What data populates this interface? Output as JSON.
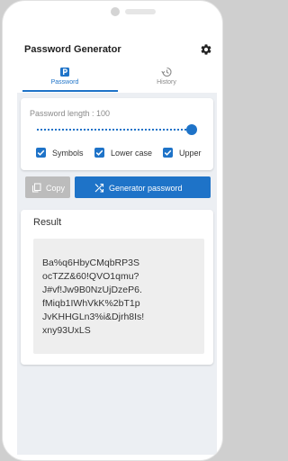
{
  "app": {
    "title": "Password Generator"
  },
  "tabs": [
    {
      "label": "Password",
      "icon": "key-box-icon",
      "active": true
    },
    {
      "label": "History",
      "icon": "history-icon",
      "active": false
    }
  ],
  "settings": {
    "length_label": "Password length : 100",
    "length_value": 100,
    "options": [
      {
        "label": "Symbols",
        "checked": true
      },
      {
        "label": "Lower case",
        "checked": true
      },
      {
        "label": "Upper",
        "checked": true
      }
    ]
  },
  "buttons": {
    "copy_label": "Copy",
    "generate_label": "Generator password"
  },
  "result": {
    "title": "Result",
    "lines": [
      "Ba%q6HbyCMqbRP3S",
      "ocTZZ&60!QVO1qmu?",
      "J#vf!Jw9B0NzUjDzeP6.",
      "fMiqb1IWhVkK%2bT1p",
      "JvKHHGLn3%i&Djrh8Is!",
      "xny93UxLS"
    ]
  },
  "colors": {
    "accent": "#1e73c8",
    "disabled": "#bcbcbc"
  }
}
